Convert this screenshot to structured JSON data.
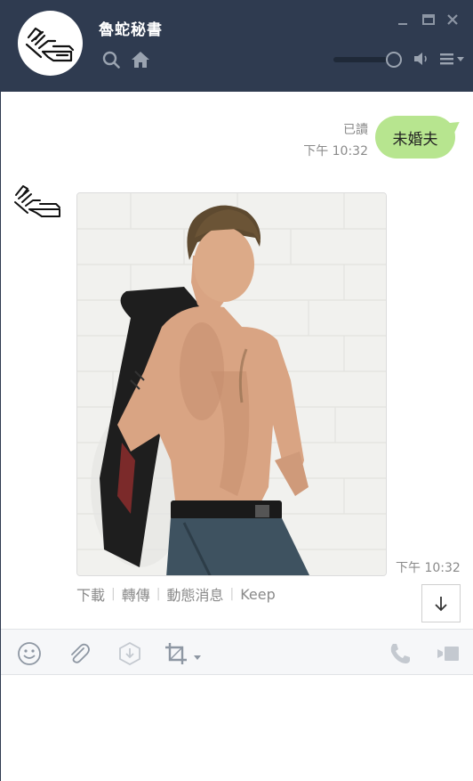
{
  "header": {
    "title": "魯蛇秘書"
  },
  "chat": {
    "sent": {
      "text": "未婚夫",
      "read": "已讀",
      "time": "下午 10:32"
    },
    "received": {
      "time": "下午 10:32",
      "actions": [
        "下載",
        "轉傳",
        "動態消息",
        "Keep"
      ]
    }
  },
  "composer": {
    "value": "",
    "placeholder": ""
  },
  "colors": {
    "header_bg": "#2f3b50",
    "bubble_green": "#b7e58f",
    "toolbar_bg": "#f6f7f9"
  },
  "icons": [
    "search-icon",
    "home-icon",
    "minimize-icon",
    "maximize-icon",
    "close-icon",
    "speaker-icon",
    "menu-icon",
    "chevron-down-icon",
    "arrow-down-icon",
    "emoji-icon",
    "paperclip-icon",
    "keep-icon",
    "crop-icon",
    "phone-icon",
    "video-icon"
  ]
}
